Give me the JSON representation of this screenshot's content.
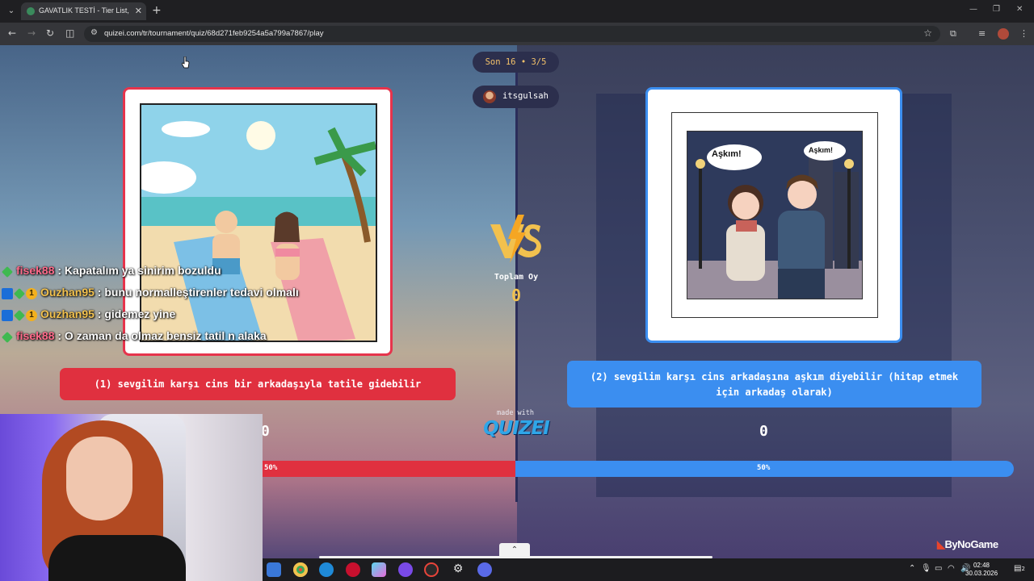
{
  "browser": {
    "tab_title": "GAVATLIK TESTİ - Tier List, Kör S",
    "url": "quizei.com/tr/tournament/quiz/68d271feb9254a5a799a7867/play"
  },
  "quiz": {
    "round": "Son 16 • 3/5",
    "username": "itsgulsah",
    "total_label": "Toplam Oy",
    "total_value": "0",
    "left": {
      "caption": "(1) sevgilim karşı cins bir arkadaşıyla tatile gidebilir",
      "votes": "0",
      "percent": "50%",
      "share": 0.5
    },
    "right": {
      "caption": "(2) sevgilim karşı cins arkadaşına aşkım diyebilir (hitap etmek için arkadaş olarak)",
      "votes": "0",
      "percent": "50%",
      "share": 0.5
    },
    "right_art_bubble_1": "Aşkım!",
    "right_art_bubble_2": "Aşkım!",
    "made_with": "made with",
    "logo": "QUIZEI"
  },
  "chat": [
    {
      "user": "fisek88",
      "user_color": "#ff6a8a",
      "badges": [
        "gem"
      ],
      "message": " : Kapatalım ya sinirim bozuldu"
    },
    {
      "user": "Ouzhan95",
      "user_color": "#f2c14e",
      "badges": [
        "mod",
        "gem",
        "num"
      ],
      "message": " : bunu normalleştirenler tedavi olmalı"
    },
    {
      "user": "Ouzhan95",
      "user_color": "#f2c14e",
      "badges": [
        "mod",
        "gem",
        "num"
      ],
      "message": " : gidemez yine"
    },
    {
      "user": "fisek88",
      "user_color": "#ff6a8a",
      "badges": [
        "gem"
      ],
      "message": " : O zaman da olmaz bensiz tatil n alaka"
    }
  ],
  "chat_badge_num": "1",
  "watermark": {
    "prefix": "By",
    "name": "NoGame"
  },
  "taskbar": {
    "time": "02:48",
    "date": "30.03.2026",
    "notifications": "2"
  }
}
